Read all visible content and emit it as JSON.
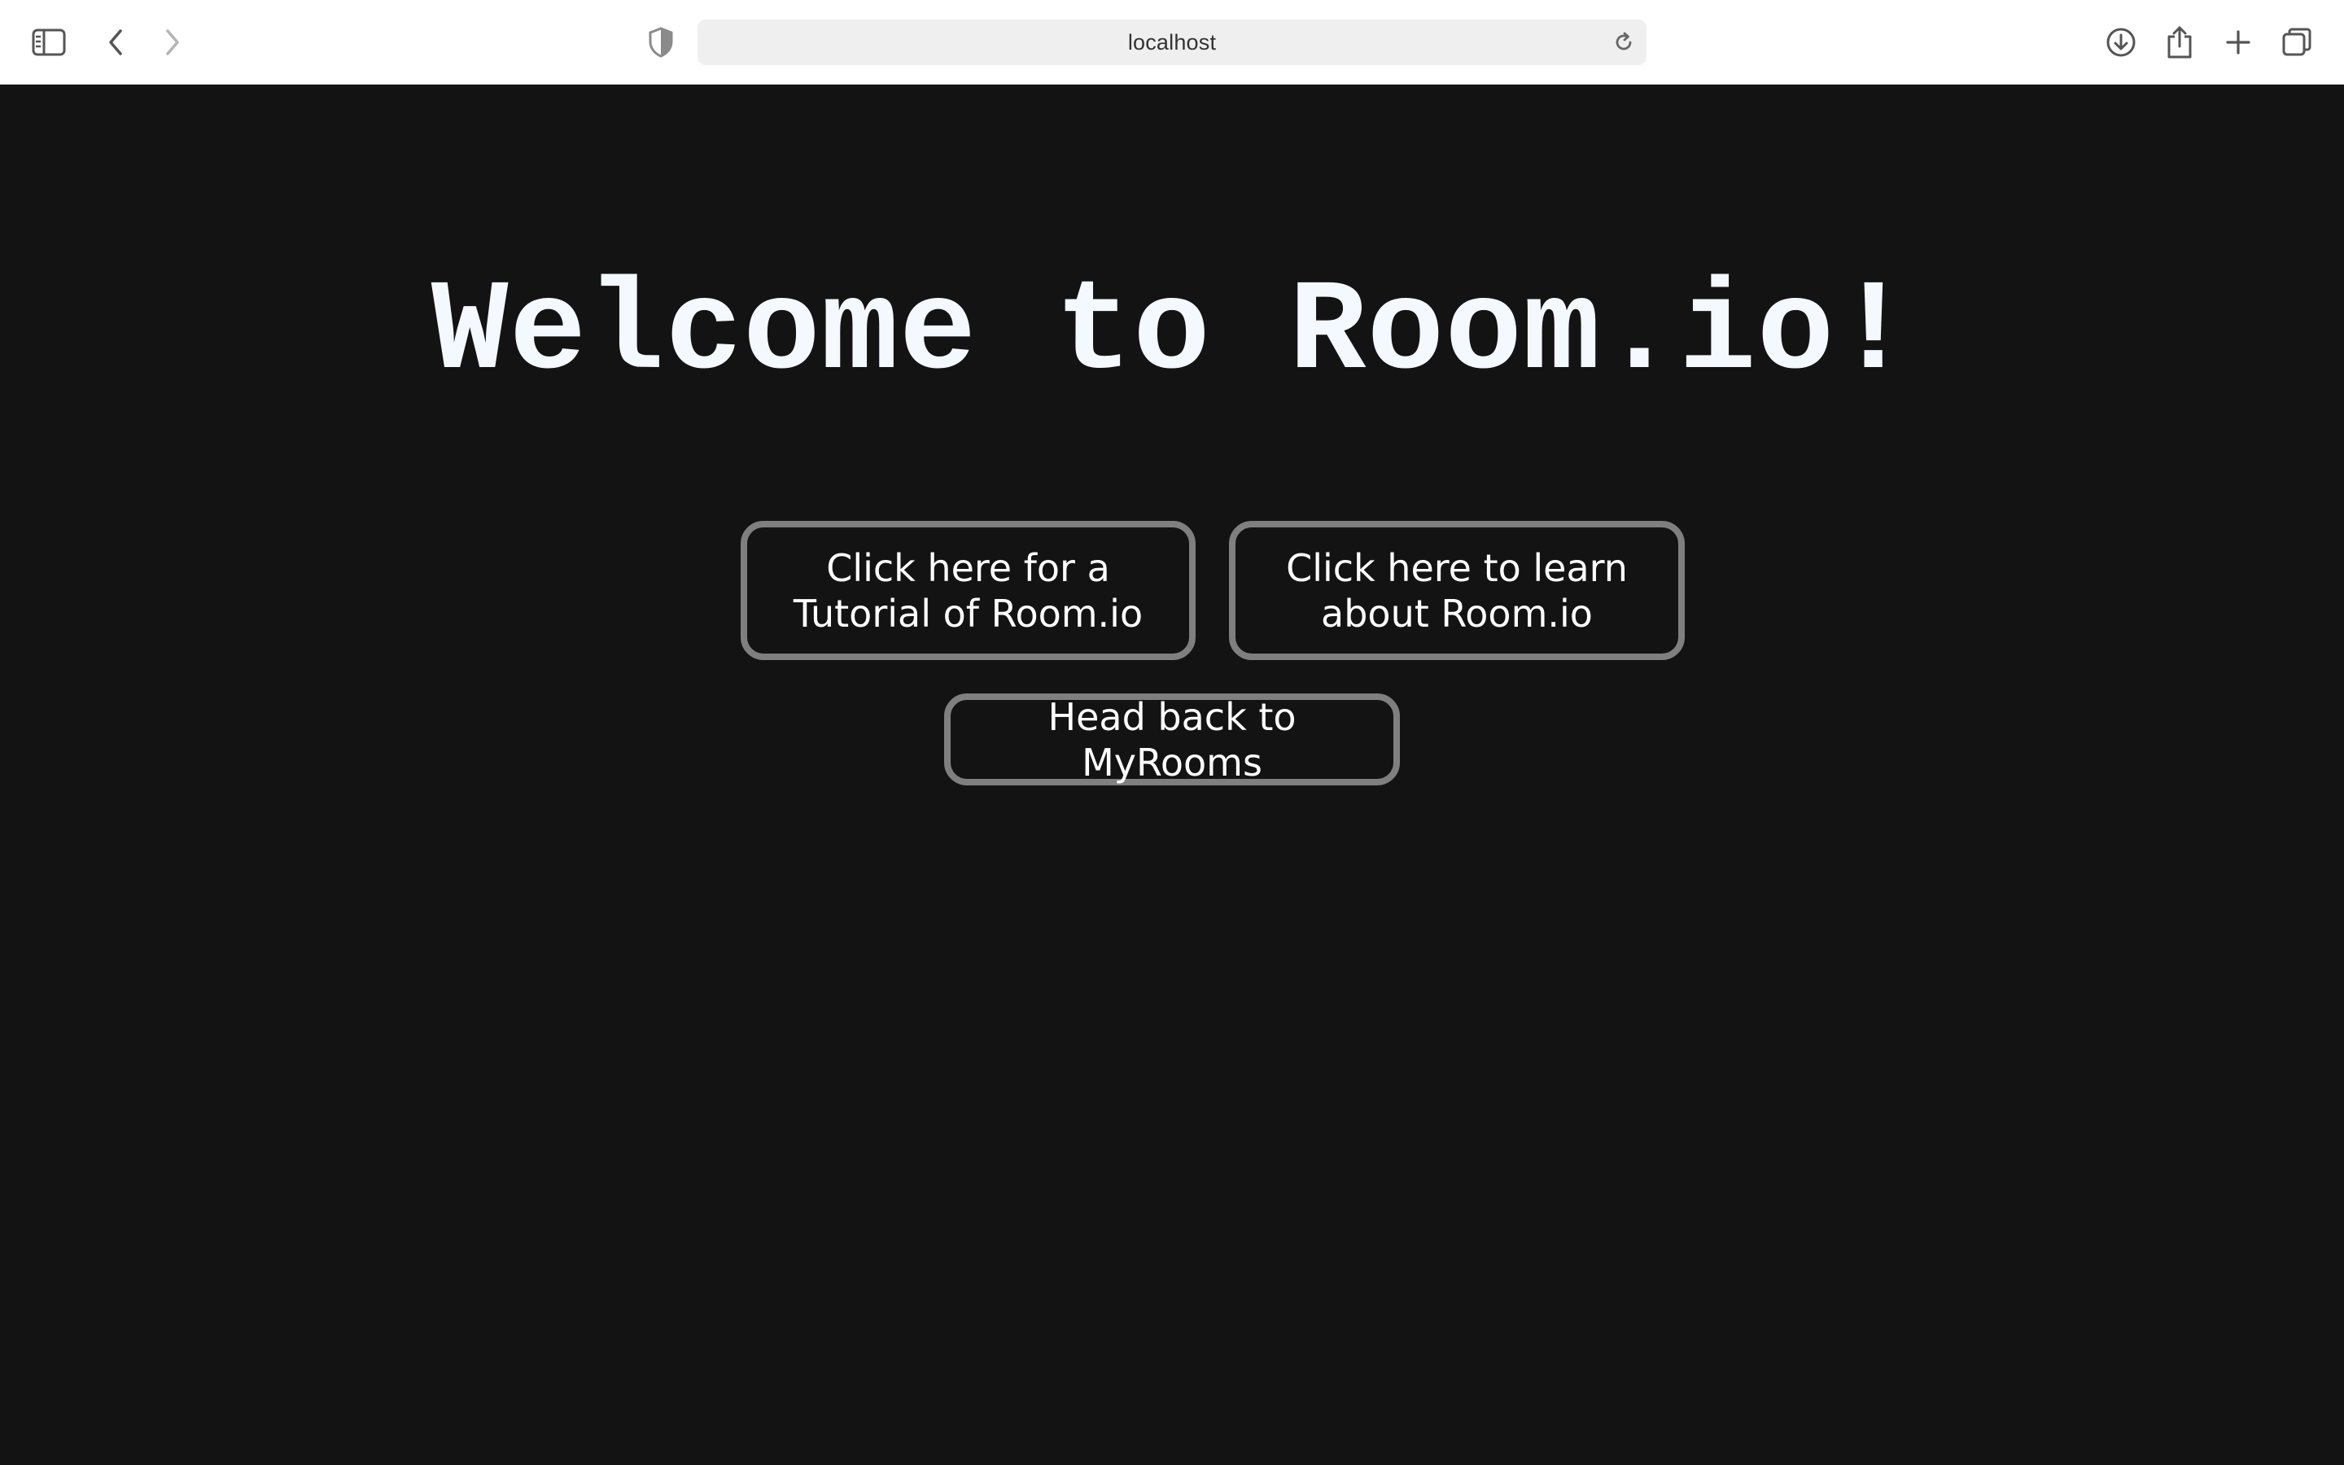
{
  "browser": {
    "address": "localhost",
    "icons": {
      "sidebar": "sidebar-icon",
      "back": "chevron-left-icon",
      "forward": "chevron-right-icon",
      "privacy": "shield-icon",
      "reload": "reload-icon",
      "download": "download-icon",
      "share": "share-icon",
      "new_tab": "plus-icon",
      "tabs": "tabs-overview-icon"
    }
  },
  "page": {
    "title": "Welcome to Room.io!",
    "buttons": {
      "tutorial": "Click here for a Tutorial of Room.io",
      "about": "Click here to learn about Room.io",
      "back": "Head back to MyRooms"
    }
  },
  "colors": {
    "background": "#131313",
    "title": "#f4f8ff",
    "button_border": "#7f7f7f",
    "button_text": "#ffffff"
  }
}
